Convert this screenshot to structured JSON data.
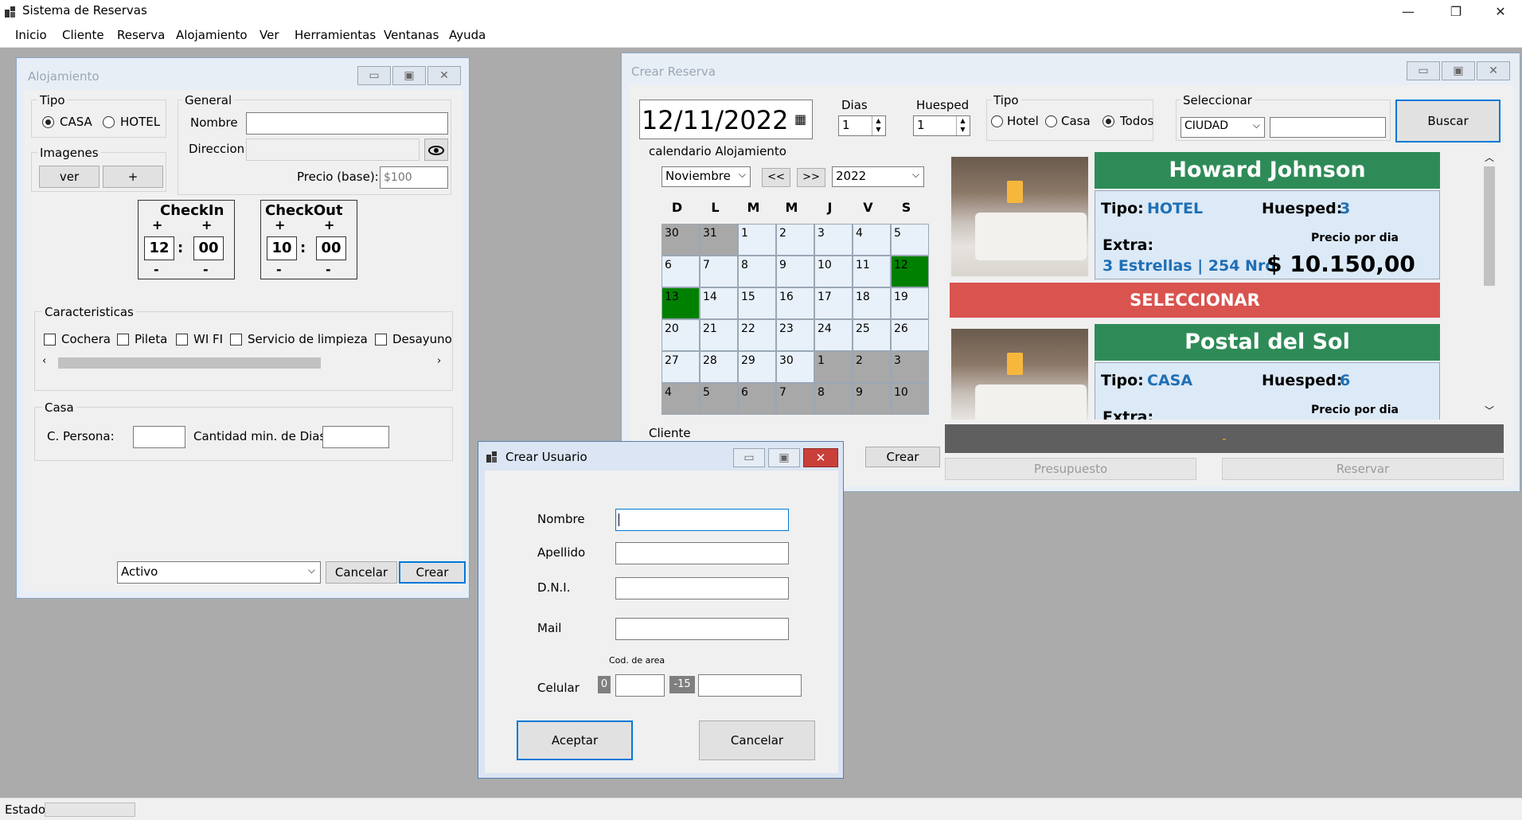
{
  "app": {
    "title": "Sistema de Reservas"
  },
  "window_controls": {
    "min": "—",
    "max": "❐",
    "close": "✕"
  },
  "menu": [
    "Inicio",
    "Cliente",
    "Reserva",
    "Alojamiento",
    "Ver",
    "Herramientas",
    "Ventanas",
    "Ayuda"
  ],
  "status": {
    "label": "Estado"
  },
  "alojamiento": {
    "title": "Alojamiento",
    "tipo": {
      "label": "Tipo",
      "options": [
        "CASA",
        "HOTEL"
      ],
      "selected": "CASA"
    },
    "imagenes": {
      "label": "Imagenes",
      "ver": "ver",
      "add": "+"
    },
    "general": {
      "label": "General",
      "nombre_label": "Nombre",
      "nombre": "",
      "direccion_label": "Direccion",
      "direccion": "",
      "precio_label": "Precio (base):",
      "precio_placeholder": "$100"
    },
    "checkin": {
      "label": "CheckIn",
      "hour": "12",
      "min": "00"
    },
    "checkout": {
      "label": "CheckOut",
      "hour": "10",
      "min": "00"
    },
    "plus": "+",
    "minus": "-",
    "colon": ":",
    "caracteristicas": {
      "label": "Caracteristicas",
      "items": [
        "Cochera",
        "Pileta",
        "WI FI",
        "Servicio de limpieza",
        "Desayuno"
      ]
    },
    "casa": {
      "label": "Casa",
      "c_persona": "C. Persona:",
      "cant_min": "Cantidad min. de Dias:"
    },
    "estado": "Activo",
    "cancelar": "Cancelar",
    "crear": "Crear"
  },
  "reserva": {
    "title": "Crear Reserva",
    "fecha": "12/11/2022",
    "dias": {
      "label": "Dias",
      "value": "1"
    },
    "huesped": {
      "label": "Huesped",
      "value": "1"
    },
    "tipo": {
      "label": "Tipo",
      "options": [
        "Hotel",
        "Casa",
        "Todos"
      ],
      "selected": "Todos"
    },
    "seleccionar": {
      "label": "Seleccionar",
      "value": "CIUDAD",
      "text": ""
    },
    "buscar": "Buscar",
    "calendario_label": "calendario Alojamiento",
    "month": "Noviembre",
    "prev": "<<",
    "next": ">>",
    "year": "2022",
    "weekdays": [
      "D",
      "L",
      "M",
      "M",
      "J",
      "V",
      "S"
    ],
    "days": [
      [
        "30",
        "31",
        "1",
        "2",
        "3",
        "4",
        "5"
      ],
      [
        "6",
        "7",
        "8",
        "9",
        "10",
        "11",
        "12"
      ],
      [
        "13",
        "14",
        "15",
        "16",
        "17",
        "18",
        "19"
      ],
      [
        "20",
        "21",
        "22",
        "23",
        "24",
        "25",
        "26"
      ],
      [
        "27",
        "28",
        "29",
        "30",
        "1",
        "2",
        "3"
      ],
      [
        "4",
        "5",
        "6",
        "7",
        "8",
        "9",
        "10"
      ]
    ],
    "cliente_label": "Cliente",
    "crear": "Crear",
    "results": [
      {
        "name": "Howard Johnson",
        "tipo_label": "Tipo:",
        "tipo": "HOTEL",
        "huesped_label": "Huesped:",
        "huesped": "3",
        "extra_label": "Extra:",
        "extra": "3 Estrellas | 254 Nro",
        "precio_label": "Precio por dia",
        "precio": "$ 10.150,00"
      },
      {
        "name": "Postal del Sol",
        "tipo_label": "Tipo:",
        "tipo": "CASA",
        "huesped_label": "Huesped:",
        "huesped": "6",
        "extra_label": "Extra:",
        "precio_label": "Precio por dia"
      }
    ],
    "seleccionar_btn": "SELECCIONAR",
    "summary": "-",
    "presupuesto": "Presupuesto",
    "reservar": "Reservar"
  },
  "usuario": {
    "title": "Crear Usuario",
    "nombre": "Nombre",
    "apellido": "Apellido",
    "dni": "D.N.I.",
    "mail": "Mail",
    "cod_area": "Cod. de area",
    "celular": "Celular",
    "prefix0": "0",
    "prefix15": "-15",
    "aceptar": "Aceptar",
    "cancelar": "Cancelar"
  },
  "colors": {
    "accent": "#0078d7",
    "card_green": "#2e8b57",
    "select_red": "#d9534f",
    "cal_green": "#008000"
  }
}
